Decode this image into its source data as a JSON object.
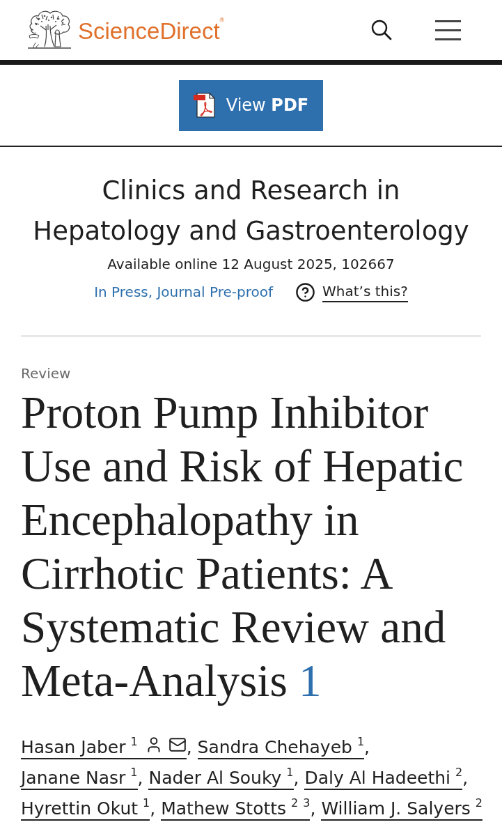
{
  "header": {
    "logo": {
      "text": "ScienceDirect",
      "mark": "®"
    }
  },
  "pdf_button": {
    "label": "View **PDF**"
  },
  "journal": {
    "title": "Clinics and Research in Hepatology and Gastroenterology",
    "availability": "Available online 12 August 2025, 102667",
    "status": "In Press, Journal Pre-proof",
    "help_link": "What’s this?"
  },
  "article": {
    "type": "Review",
    "title": "Proton Pump Inhibitor Use and Risk of Hepatic Encephalopathy in Cirrhotic Patients: A Systematic Review and Meta-Analysis",
    "footnote": "1",
    "authors": [
      {
        "name": "Hasan Jaber",
        "affiliations": [
          "1"
        ],
        "has_profile": true,
        "corresponding": true,
        "separator": ","
      },
      {
        "name": "Sandra Chehayeb",
        "affiliations": [
          "1"
        ],
        "has_profile": false,
        "corresponding": false,
        "separator": ","
      },
      {
        "name": "Janane Nasr",
        "affiliations": [
          "1"
        ],
        "has_profile": false,
        "corresponding": false,
        "separator": ","
      },
      {
        "name": "Nader Al Souky",
        "affiliations": [
          "1"
        ],
        "has_profile": false,
        "corresponding": false,
        "separator": ","
      },
      {
        "name": "Daly Al Hadeethi",
        "affiliations": [
          "2"
        ],
        "has_profile": false,
        "corresponding": false,
        "separator": ","
      },
      {
        "name": "Hyrettin Okut",
        "affiliations": [
          "1"
        ],
        "has_profile": false,
        "corresponding": false,
        "separator": ","
      },
      {
        "name": "Mathew Stotts",
        "affiliations": [
          "2",
          "3"
        ],
        "has_profile": false,
        "corresponding": false,
        "separator": ","
      },
      {
        "name": "William J. Salyers",
        "affiliations": [
          "2"
        ],
        "has_profile": false,
        "corresponding": false
      }
    ]
  }
}
